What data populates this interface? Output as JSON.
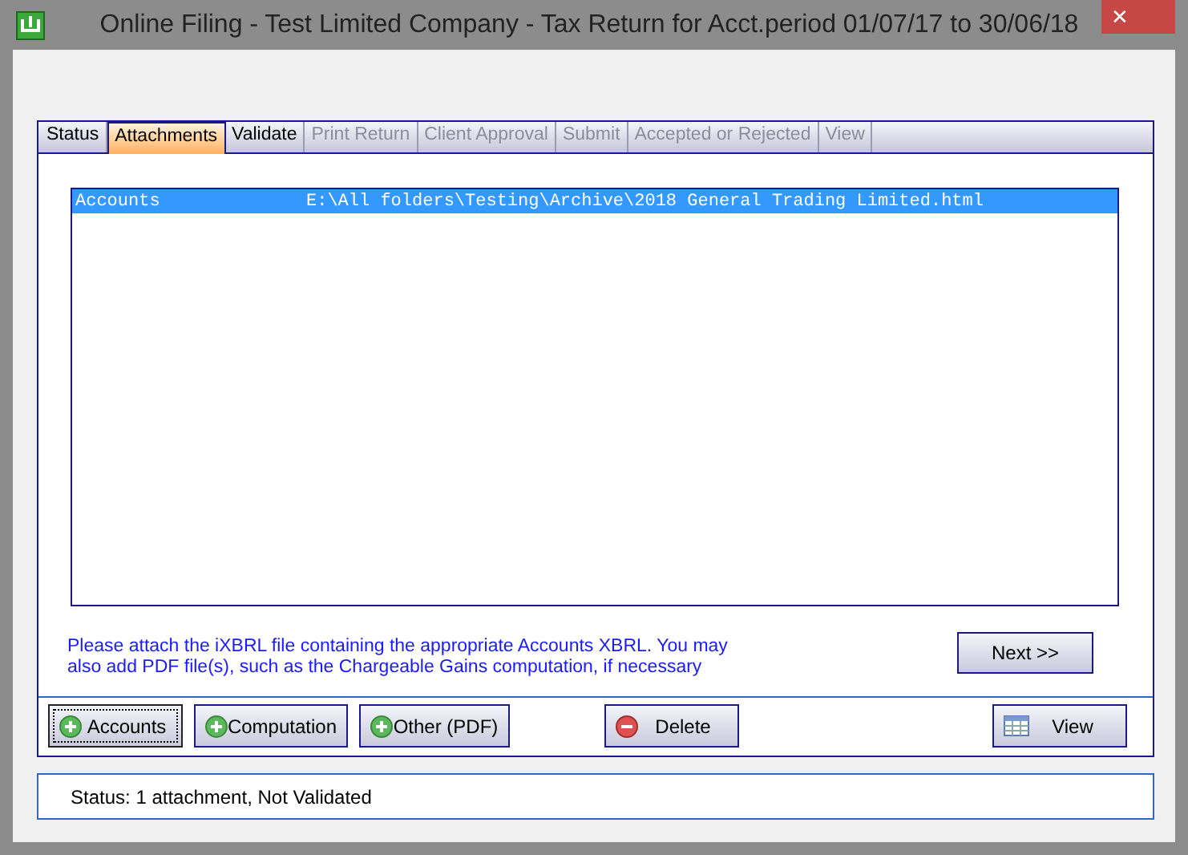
{
  "window": {
    "title": "Online Filing - Test Limited Company - Tax Return for Acct.period 01/07/17 to 30/06/18",
    "close": "✕"
  },
  "tabs": [
    {
      "label": "Status",
      "selected": false,
      "disabled": false
    },
    {
      "label": "Attachments",
      "selected": true,
      "disabled": false
    },
    {
      "label": "Validate",
      "selected": false,
      "disabled": false
    },
    {
      "label": "Print Return",
      "selected": false,
      "disabled": true
    },
    {
      "label": "Client Approval",
      "selected": false,
      "disabled": true
    },
    {
      "label": "Submit",
      "selected": false,
      "disabled": true
    },
    {
      "label": "Accepted or Rejected",
      "selected": false,
      "disabled": true
    },
    {
      "label": "View",
      "selected": false,
      "disabled": true
    }
  ],
  "attachments": [
    {
      "type": "Accounts",
      "path": "E:\\All folders\\Testing\\Archive\\2018 General Trading Limited.html",
      "selected": true
    }
  ],
  "message": "Please attach the iXBRL file containing the appropriate Accounts XBRL. You may also add PDF file(s), such as the Chargeable Gains computation, if necessary",
  "next_button": "Next >>",
  "buttons": [
    {
      "label": "Accounts",
      "kind": "add",
      "focused": true
    },
    {
      "label": "Computation",
      "kind": "add",
      "focused": false
    },
    {
      "label": "Other (PDF)",
      "kind": "add",
      "focused": false
    },
    {
      "label": "Delete",
      "kind": "delete",
      "focused": false
    },
    {
      "label": "View",
      "kind": "view",
      "focused": false
    }
  ],
  "status_bar": "Status: 1 attachment, Not Validated"
}
